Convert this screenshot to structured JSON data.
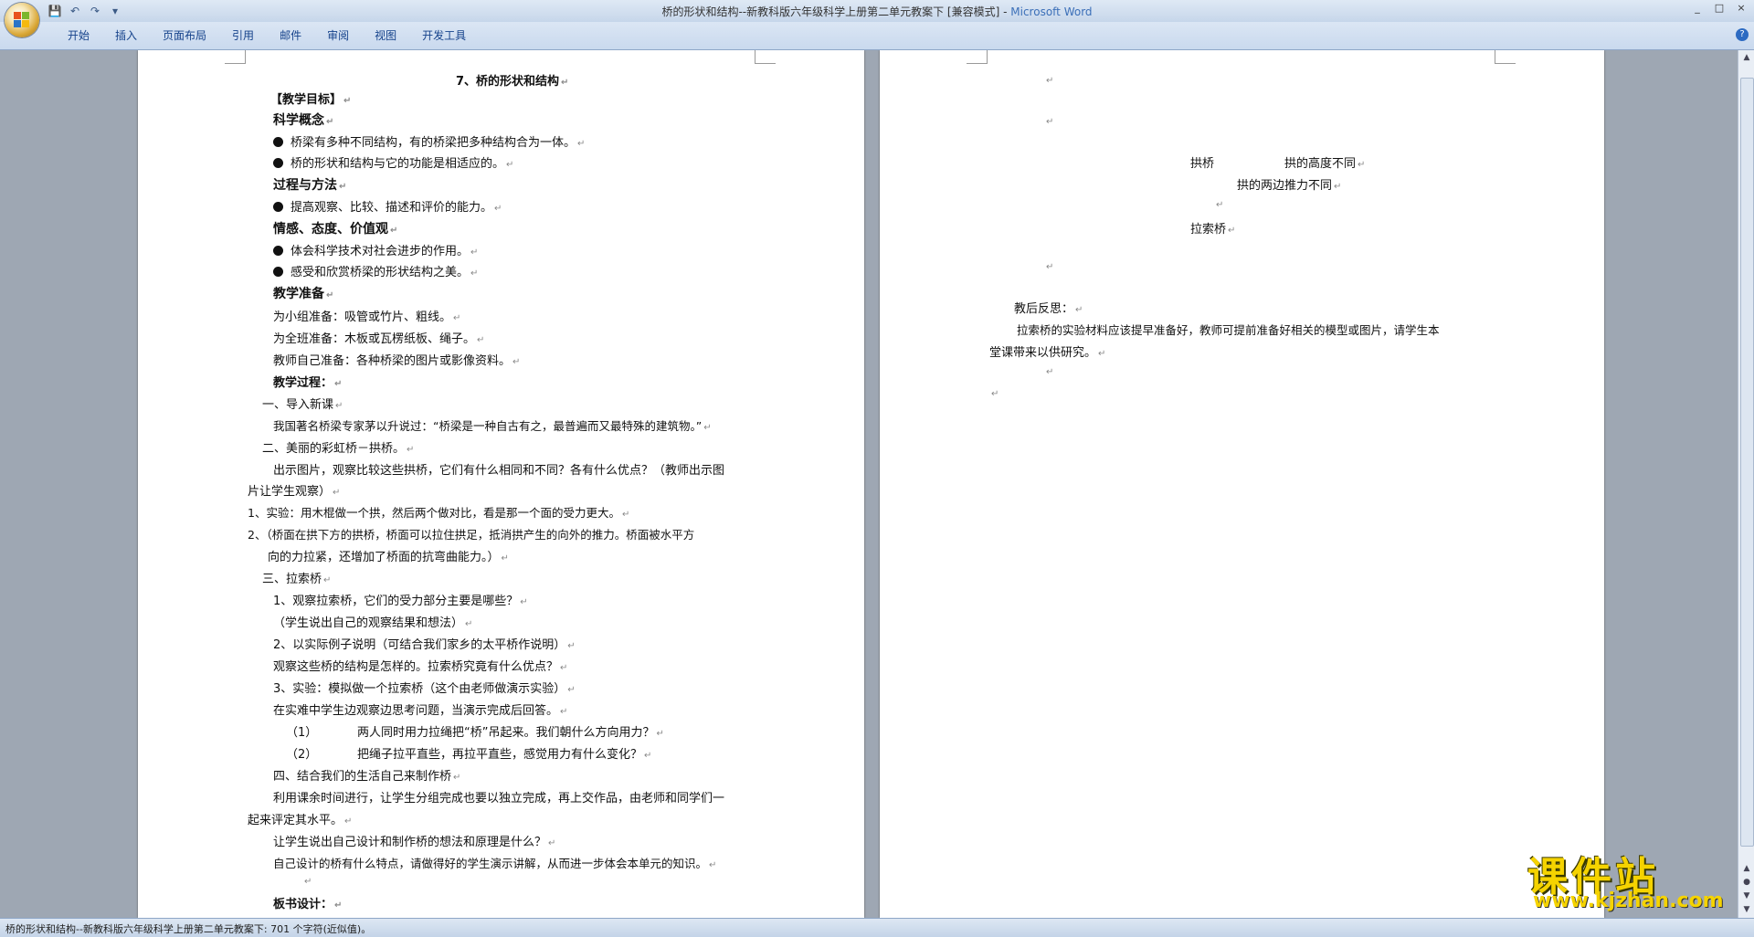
{
  "window": {
    "title": "桥的形状和结构--新教科版六年级科学上册第二单元教案下 [兼容模式]",
    "app_name": "Microsoft Word",
    "controls": [
      "_",
      "□",
      "×"
    ]
  },
  "qat": {
    "save": "💾",
    "undo": "↶",
    "redo": "↷",
    "more": "▾"
  },
  "ribbon": {
    "tabs": [
      "开始",
      "插入",
      "页面布局",
      "引用",
      "邮件",
      "审阅",
      "视图",
      "开发工具"
    ],
    "help": "?"
  },
  "page1": {
    "lines": [
      "7、桥的形状和结构",
      "【教学目标】",
      "科学概念",
      "桥梁有多种不同结构，有的桥梁把多种结构合为一体。",
      "桥的形状和结构与它的功能是相适应的。",
      "过程与方法",
      "提高观察、比较、描述和评价的能力。",
      "情感、态度、价值观",
      "体会科学技术对社会进步的作用。",
      "感受和欣赏桥梁的形状结构之美。",
      "教学准备",
      "为小组准备：吸管或竹片、粗线。",
      "为全班准备：木板或瓦楞纸板、绳子。",
      "教师自己准备：各种桥梁的图片或影像资料。",
      "教学过程：",
      "一、导入新课",
      "我国著名桥梁专家茅以升说过：“桥梁是一种自古有之，最普遍而又最特殊的建筑物。”",
      "二、美丽的彩虹桥－拱桥。",
      "出示图片，观察比较这些拱桥，它们有什么相同和不同？各有什么优点？（教师出示图",
      "片让学生观察）",
      "1、实验：用木棍做一个拱，然后两个做对比，看是那一个面的受力更大。",
      "2、（桥面在拱下方的拱桥，桥面可以拉住拱足，抵消拱产生的向外的推力。桥面被水平方",
      "向的力拉紧，还增加了桥面的抗弯曲能力。）",
      "三、拉索桥",
      "1、观察拉索桥，它们的受力部分主要是哪些？",
      "（学生说出自己的观察结果和想法）",
      "2、以实际例子说明（可结合我们家乡的太平桥作说明）",
      "观察这些桥的结构是怎样的。拉索桥究竟有什么优点？",
      "3、实验：模拟做一个拉索桥（这个由老师做演示实验）",
      "在实难中学生边观察边思考问题，当演示完成后回答。",
      "（1）",
      "两人同时用力拉绳把“桥”吊起来。我们朝什么方向用力？",
      "（2）",
      "把绳子拉平直些，再拉平直些，感觉用力有什么变化？",
      "四、结合我们的生活自己来制作桥",
      "利用课余时间进行，让学生分组完成也要以独立完成，再上交作品，由老师和同学们一",
      "起来评定其水平。",
      "让学生说出自己设计和制作桥的想法和原理是什么？",
      "自己设计的桥有什么特点，请做得好的学生演示讲解，从而进一步体会本单元的知识。",
      "板书设计："
    ]
  },
  "page2": {
    "lines": [
      "拱桥",
      "拱的高度不同",
      "拱的两边推力不同",
      "拉索桥",
      "教后反思：",
      "拉索桥的实验材料应该提早准备好，教师可提前准备好相关的模型或图片，请学生本",
      "堂课带来以供研究。"
    ]
  },
  "marks": {
    "para": "↵"
  },
  "status": {
    "text": "桥的形状和结构--新教科版六年级科学上册第二单元教案下: 701 个字符(近似值)。"
  },
  "watermark": {
    "title": "课件站",
    "url": "www.kjzhan.com"
  },
  "colors": {
    "ribbon_text": "#15428b",
    "brand_blue": "#3b6fb8",
    "watermark": "#f5d300"
  }
}
